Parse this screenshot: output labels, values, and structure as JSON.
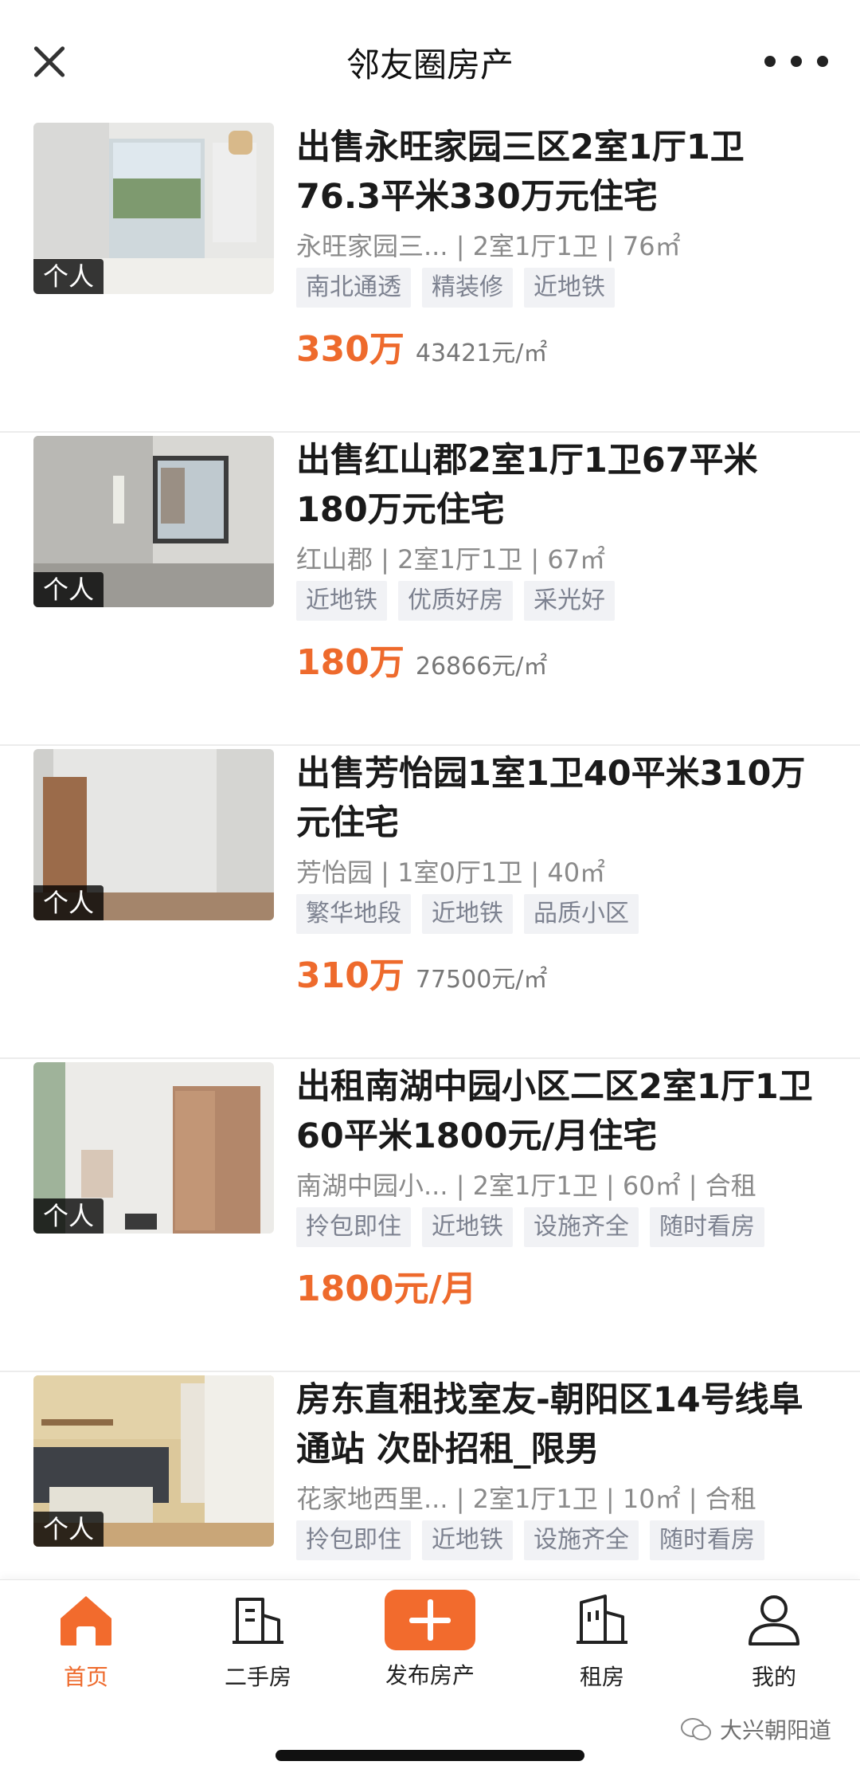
{
  "header": {
    "title": "邻友圈房产"
  },
  "listings": [
    {
      "thumb_tag": "个人",
      "title": "出售永旺家园三区2室1厅1卫76.3平米330万元住宅",
      "meta": "永旺家园三... | 2室1厅1卫 | 76㎡",
      "tags": [
        "南北通透",
        "精装修",
        "近地铁"
      ],
      "price": "330万",
      "unit_price": "43421元/㎡"
    },
    {
      "thumb_tag": "个人",
      "title": "出售红山郡2室1厅1卫67平米180万元住宅",
      "meta": "红山郡 | 2室1厅1卫 | 67㎡",
      "tags": [
        "近地铁",
        "优质好房",
        "采光好"
      ],
      "price": "180万",
      "unit_price": "26866元/㎡"
    },
    {
      "thumb_tag": "个人",
      "title": "出售芳怡园1室1卫40平米310万元住宅",
      "meta": "芳怡园 | 1室0厅1卫 | 40㎡",
      "tags": [
        "繁华地段",
        "近地铁",
        "品质小区"
      ],
      "price": "310万",
      "unit_price": "77500元/㎡"
    },
    {
      "thumb_tag": "个人",
      "title": "出租南湖中园小区二区2室1厅1卫60平米1800元/月住宅",
      "meta": "南湖中园小... | 2室1厅1卫 | 60㎡ | 合租",
      "tags": [
        "拎包即住",
        "近地铁",
        "设施齐全",
        "随时看房"
      ],
      "price": "1800元/月",
      "unit_price": ""
    },
    {
      "thumb_tag": "个人",
      "title": "房东直租找室友-朝阳区14号线阜通站 次卧招租_限男",
      "meta": "花家地西里... | 2室1厅1卫 | 10㎡ | 合租",
      "tags": [
        "拎包即住",
        "近地铁",
        "设施齐全",
        "随时看房"
      ],
      "price": "",
      "unit_price": ""
    }
  ],
  "tabbar": {
    "items": [
      {
        "label": "首页",
        "icon": "home-icon",
        "active": true
      },
      {
        "label": "二手房",
        "icon": "building-icon"
      },
      {
        "label": "发布房产",
        "icon": "plus-icon"
      },
      {
        "label": "租房",
        "icon": "rent-building-icon"
      },
      {
        "label": "我的",
        "icon": "user-icon"
      }
    ]
  },
  "watermark": "大兴朝阳道",
  "colors": {
    "accent": "#ee6a2c",
    "tag_bg": "#f1f2f5",
    "tag_text": "#7d8290"
  }
}
